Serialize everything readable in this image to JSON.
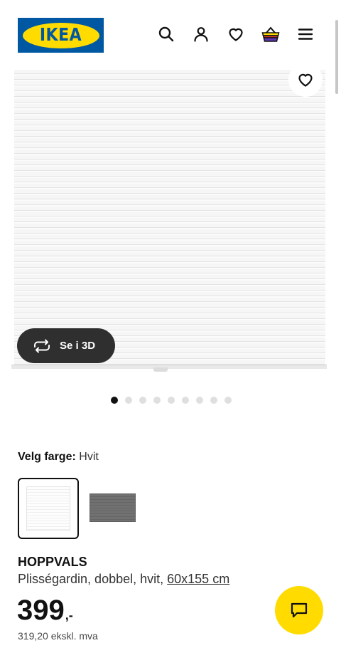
{
  "header": {
    "logo_text": "IKEA",
    "icons": [
      "search-icon",
      "user-icon",
      "heart-icon",
      "shopping-bag-icon",
      "menu-icon"
    ]
  },
  "media": {
    "view_3d_label": "Se i 3D",
    "view_3d_icon": "rotate-icon",
    "favorite_icon": "heart-icon",
    "carousel": {
      "total_images": 9,
      "active_index": 0
    }
  },
  "color_selector": {
    "label": "Velg farge:",
    "selected_value": "Hvit",
    "options": [
      {
        "name": "Hvit",
        "selected": true,
        "color": "#f4f4f4"
      },
      {
        "name": "Grå",
        "selected": false,
        "color": "#6b6b6b"
      }
    ]
  },
  "product": {
    "name": "HOPPVALS",
    "description": "Plisségardin, dobbel, hvit,",
    "size_link": "60x155 cm",
    "price_main": "399",
    "price_suffix": ",-",
    "price_ex_vat": "319,20 ekskl. mva"
  },
  "chat": {
    "icon": "chat-icon"
  },
  "colors": {
    "brand_blue": "#0058a3",
    "brand_yellow": "#ffdb00",
    "text_primary": "#111111",
    "button_dark": "#2f2f2f"
  }
}
